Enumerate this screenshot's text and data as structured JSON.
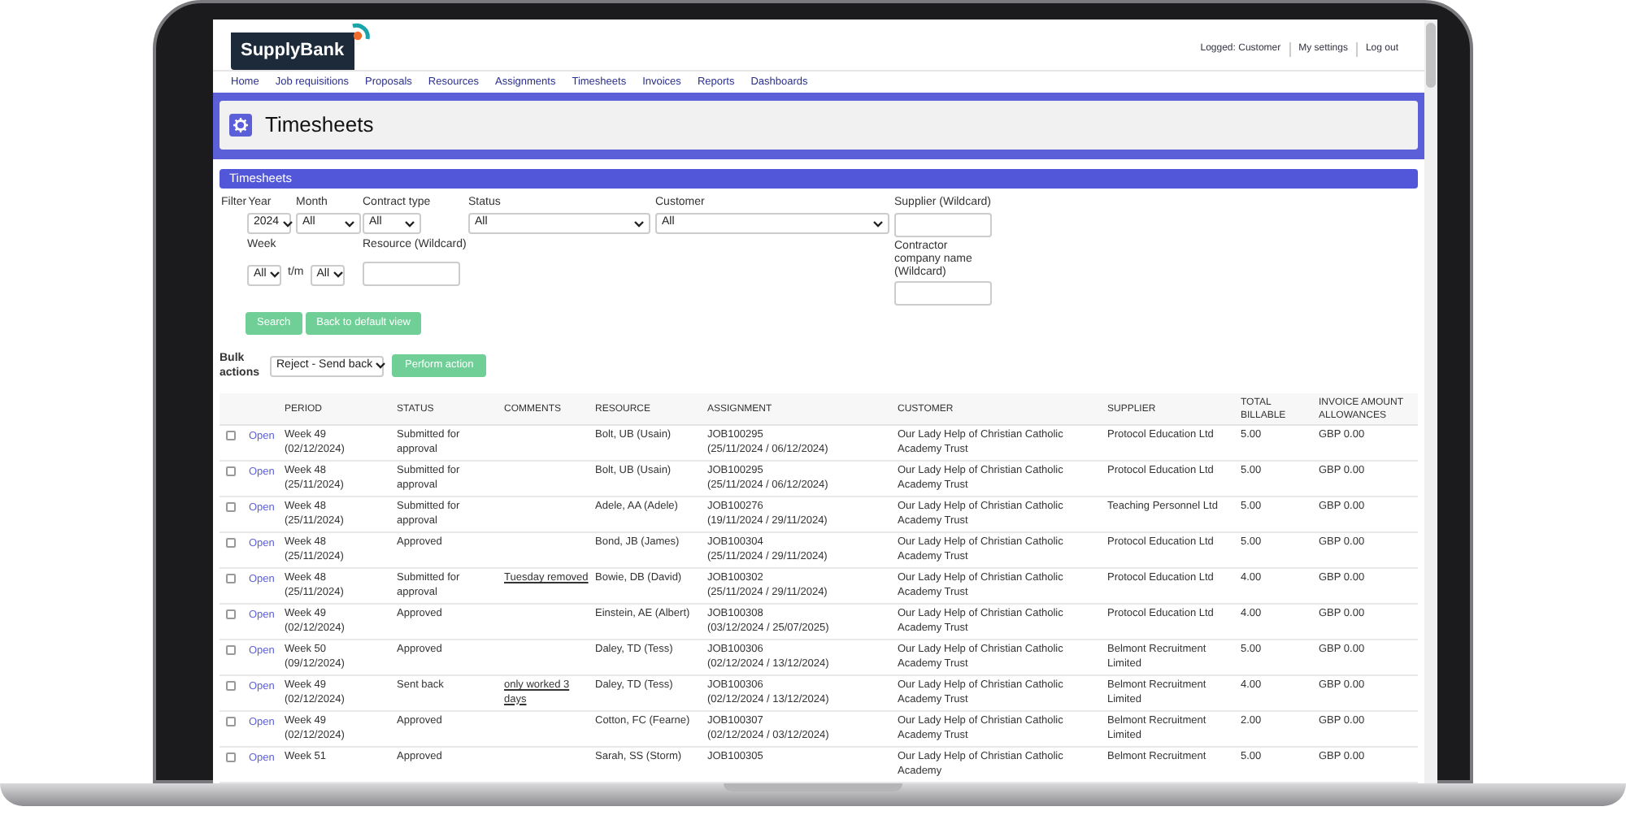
{
  "header": {
    "logo": "SupplyBank",
    "user_links": [
      "Logged: Customer",
      "My settings",
      "Log out"
    ]
  },
  "nav": [
    "Home",
    "Job requisitions",
    "Proposals",
    "Resources",
    "Assignments",
    "Timesheets",
    "Invoices",
    "Reports",
    "Dashboards"
  ],
  "page_title": "Timesheets",
  "panel": {
    "title": "Timesheets",
    "filters": {
      "label": "Filter",
      "year": {
        "label": "Year",
        "value": "2024"
      },
      "month": {
        "label": "Month",
        "value": "All"
      },
      "contract_type": {
        "label": "Contract type",
        "value": "All"
      },
      "status": {
        "label": "Status",
        "value": "All"
      },
      "customer": {
        "label": "Customer",
        "value": "All"
      },
      "supplier": {
        "label": "Supplier (Wildcard)"
      },
      "week": {
        "label": "Week",
        "from": "All",
        "to_label": "t/m",
        "to": "All"
      },
      "resource": {
        "label": "Resource (Wildcard)"
      },
      "contractor_company": {
        "label": "Contractor company name (Wildcard)"
      }
    },
    "buttons": [
      "Search",
      "Back to default view"
    ],
    "bulk_actions": {
      "label": "Bulk actions",
      "value": "Reject - Send back",
      "button": "Perform action"
    }
  },
  "table": {
    "columns": [
      "PERIOD",
      "STATUS",
      "COMMENTS",
      "RESOURCE",
      "ASSIGNMENT",
      "CUSTOMER",
      "SUPPLIER",
      "TOTAL BILLABLE",
      "INVOICE AMOUNT ALLOWANCES"
    ],
    "rows": [
      {
        "checked": false,
        "link": "Open",
        "period": "Week 49\n(02/12/2024)",
        "status": "Submitted for approval",
        "resource": "Bolt, UB (Usain)",
        "assignment": "JOB100295\n(25/11/2024 / 06/12/2024)",
        "customer": "Our Lady Help of Christian Catholic Academy Trust",
        "supplier": "Protocol Education Ltd",
        "total": "5.00",
        "invoice": "GBP 0.00"
      },
      {
        "checked": false,
        "link": "Open",
        "period": "Week 48\n(25/11/2024)",
        "status": "Submitted for approval",
        "resource": "Bolt, UB (Usain)",
        "assignment": "JOB100295\n(25/11/2024 / 06/12/2024)",
        "customer": "Our Lady Help of Christian Catholic Academy Trust",
        "supplier": "Protocol Education Ltd",
        "total": "5.00",
        "invoice": "GBP 0.00"
      },
      {
        "checked": false,
        "link": "Open",
        "period": "Week 48\n(25/11/2024)",
        "status": "Submitted for approval",
        "resource": "Adele, AA (Adele)",
        "assignment": "JOB100276\n(19/11/2024 / 29/11/2024)",
        "customer": "Our Lady Help of Christian Catholic Academy Trust",
        "supplier": "Teaching Personnel Ltd",
        "total": "5.00",
        "invoice": "GBP 0.00"
      },
      {
        "checked": false,
        "link": "Open",
        "period": "Week 48\n(25/11/2024)",
        "status": "Approved",
        "resource": "Bond, JB (James)",
        "assignment": "JOB100304\n(25/11/2024 / 29/11/2024)",
        "customer": "Our Lady Help of Christian Catholic Academy Trust",
        "supplier": "Protocol Education Ltd",
        "total": "5.00",
        "invoice": "GBP 0.00"
      },
      {
        "checked": false,
        "link": "Open",
        "period": "Week 48\n(25/11/2024)",
        "status": "Submitted for approval",
        "comment": "Tuesday removed",
        "resource": "Bowie, DB (David)",
        "assignment": "JOB100302\n(25/11/2024 / 29/11/2024)",
        "customer": "Our Lady Help of Christian Catholic Academy Trust",
        "supplier": "Protocol Education Ltd",
        "total": "4.00",
        "invoice": "GBP 0.00"
      },
      {
        "checked": false,
        "link": "Open",
        "period": "Week 49\n(02/12/2024)",
        "status": "Approved",
        "resource": "Einstein, AE (Albert)",
        "assignment": "JOB100308\n(03/12/2024 / 25/07/2025)",
        "customer": "Our Lady Help of Christian Catholic Academy Trust",
        "supplier": "Protocol Education Ltd",
        "total": "4.00",
        "invoice": "GBP 0.00"
      },
      {
        "checked": false,
        "link": "Open",
        "period": "Week 50\n(09/12/2024)",
        "status": "Approved",
        "resource": "Daley, TD (Tess)",
        "assignment": "JOB100306\n(02/12/2024 / 13/12/2024)",
        "customer": "Our Lady Help of Christian Catholic Academy Trust",
        "supplier": "Belmont Recruitment Limited",
        "total": "5.00",
        "invoice": "GBP 0.00"
      },
      {
        "checked": false,
        "link": "Open",
        "period": "Week 49\n(02/12/2024)",
        "status": "Sent back",
        "comment": "only worked 3 days",
        "resource": "Daley, TD (Tess)",
        "assignment": "JOB100306\n(02/12/2024 / 13/12/2024)",
        "customer": "Our Lady Help of Christian Catholic Academy Trust",
        "supplier": "Belmont Recruitment Limited",
        "total": "4.00",
        "invoice": "GBP 0.00"
      },
      {
        "checked": false,
        "link": "Open",
        "period": "Week 49\n(02/12/2024)",
        "status": "Approved",
        "resource": "Cotton, FC (Fearne)",
        "assignment": "JOB100307\n(02/12/2024 / 03/12/2024)",
        "customer": "Our Lady Help of Christian Catholic Academy Trust",
        "supplier": "Belmont Recruitment Limited",
        "total": "2.00",
        "invoice": "GBP 0.00"
      },
      {
        "checked": false,
        "link": "Open",
        "period": "Week 51",
        "status": "Approved",
        "resource": "Sarah, SS (Storm)",
        "assignment": "JOB100305",
        "customer": "Our Lady Help of Christian Catholic Academy",
        "supplier": "Belmont Recruitment",
        "total": "5.00",
        "invoice": "GBP 0.00"
      }
    ]
  }
}
